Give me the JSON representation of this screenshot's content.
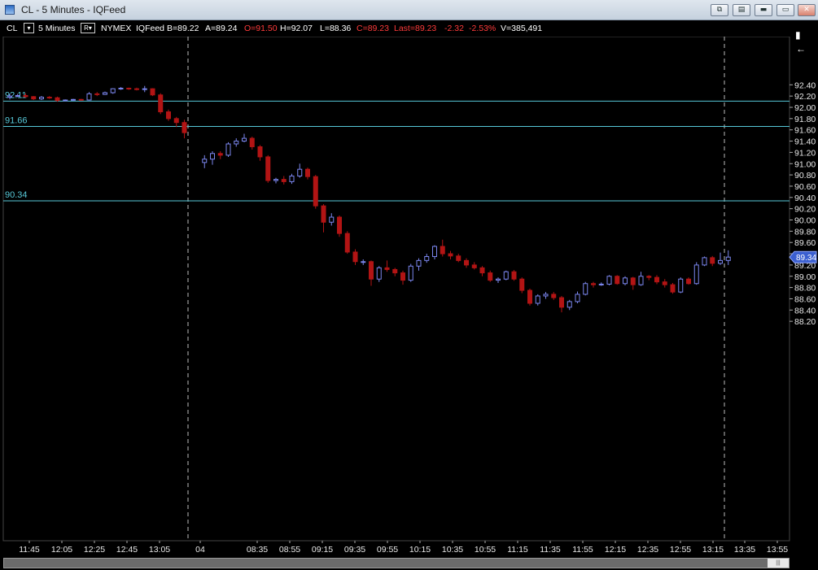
{
  "window": {
    "title": "CL - 5 Minutes - IQFeed",
    "buttons": {
      "restore": "⧉",
      "properties": "▤",
      "minimize": "▬",
      "maximize": "▭",
      "close": "✕"
    }
  },
  "infobar": {
    "symbol": "CL",
    "interval": "5 Minutes",
    "exchange": "NYMEX",
    "feed": "IQFeed",
    "bid": "B=89.22",
    "ask": "A=89.24",
    "open": "O=91.50",
    "high": "H=92.07",
    "low": "L=88.36",
    "close": "C=89.23",
    "last": "Last=89.23",
    "change": "-2.32",
    "change_pct": "-2.53%",
    "volume": "V=385,491",
    "interval_btn": "▾",
    "range_btn": "R▾"
  },
  "colors": {
    "up": "#7b86ee",
    "down": "#b21414",
    "grid": "#3a3a3a",
    "level": "#57c8d8",
    "axis_text": "#e8e8e8",
    "header_red": "#ff3b3b"
  },
  "icons": {
    "pin": "pin-icon",
    "arrow": "arrow-icon"
  },
  "chart_data": {
    "type": "candlestick",
    "symbol": "CL",
    "ylim": [
      88.15,
      92.6
    ],
    "y_ticks": [
      "92.40",
      "92.20",
      "92.00",
      "91.80",
      "91.60",
      "91.40",
      "91.20",
      "91.00",
      "90.80",
      "90.60",
      "90.40",
      "90.20",
      "90.00",
      "89.80",
      "89.60",
      "89.40",
      "89.20",
      "89.00",
      "88.80",
      "88.60",
      "88.40",
      "88.20"
    ],
    "x_ticks": [
      "11:45",
      "12:05",
      "12:25",
      "12:45",
      "13:05",
      "04",
      "08:35",
      "08:55",
      "09:15",
      "09:35",
      "09:55",
      "10:15",
      "10:35",
      "10:55",
      "11:15",
      "11:35",
      "11:55",
      "12:15",
      "12:35",
      "12:55",
      "13:15",
      "13:35",
      "13:55"
    ],
    "levels": [
      "92.11",
      "91.66",
      "90.34"
    ],
    "last_price": "89.34",
    "bars": [
      [
        92.18,
        92.2,
        92.14,
        92.24
      ],
      [
        92.2,
        92.21,
        92.18,
        92.24
      ],
      [
        92.21,
        92.19,
        92.17,
        92.25
      ],
      [
        92.19,
        92.15,
        92.13,
        92.2
      ],
      [
        92.15,
        92.18,
        92.13,
        92.2
      ],
      [
        92.18,
        92.17,
        92.15,
        92.2
      ],
      [
        92.17,
        92.12,
        92.1,
        92.19
      ],
      [
        92.12,
        92.13,
        92.11,
        92.14
      ],
      [
        92.13,
        92.14,
        92.12,
        92.15
      ],
      [
        92.14,
        92.13,
        92.12,
        92.15
      ],
      [
        92.13,
        92.24,
        92.12,
        92.27
      ],
      [
        92.24,
        92.23,
        92.2,
        92.27
      ],
      [
        92.23,
        92.26,
        92.22,
        92.28
      ],
      [
        92.26,
        92.33,
        92.24,
        92.34
      ],
      [
        92.33,
        92.34,
        92.31,
        92.36
      ],
      [
        92.34,
        92.33,
        92.31,
        92.35
      ],
      [
        92.33,
        92.32,
        92.3,
        92.35
      ],
      [
        92.32,
        92.33,
        92.27,
        92.38
      ],
      [
        92.33,
        92.22,
        92.2,
        92.34
      ],
      [
        92.22,
        91.92,
        91.88,
        92.25
      ],
      [
        91.92,
        91.8,
        91.76,
        91.96
      ],
      [
        91.8,
        91.73,
        91.65,
        91.83
      ],
      [
        91.73,
        91.55,
        91.45,
        91.78
      ],
      [
        91.02,
        91.08,
        90.92,
        91.15
      ],
      [
        91.08,
        91.18,
        90.98,
        91.22
      ],
      [
        91.18,
        91.15,
        91.08,
        91.22
      ],
      [
        91.15,
        91.35,
        91.12,
        91.38
      ],
      [
        91.35,
        91.4,
        91.3,
        91.45
      ],
      [
        91.4,
        91.45,
        91.38,
        91.53
      ],
      [
        91.45,
        91.3,
        91.25,
        91.48
      ],
      [
        91.3,
        91.12,
        91.05,
        91.33
      ],
      [
        91.12,
        90.7,
        90.66,
        91.15
      ],
      [
        90.7,
        90.72,
        90.65,
        90.75
      ],
      [
        90.72,
        90.68,
        90.63,
        90.78
      ],
      [
        90.68,
        90.78,
        90.64,
        90.82
      ],
      [
        90.78,
        90.9,
        90.75,
        91.0
      ],
      [
        90.9,
        90.77,
        90.72,
        90.93
      ],
      [
        90.77,
        90.25,
        90.2,
        90.8
      ],
      [
        90.25,
        89.96,
        89.78,
        90.28
      ],
      [
        89.96,
        90.05,
        89.9,
        90.12
      ],
      [
        90.05,
        89.76,
        89.7,
        90.08
      ],
      [
        89.76,
        89.43,
        89.4,
        89.8
      ],
      [
        89.43,
        89.26,
        89.2,
        89.48
      ],
      [
        89.26,
        89.26,
        89.2,
        89.3
      ],
      [
        89.26,
        88.95,
        88.83,
        89.28
      ],
      [
        88.95,
        89.15,
        88.9,
        89.18
      ],
      [
        89.15,
        89.12,
        89.08,
        89.28
      ],
      [
        89.12,
        89.06,
        89.0,
        89.15
      ],
      [
        89.06,
        88.93,
        88.85,
        89.1
      ],
      [
        88.93,
        89.18,
        88.9,
        89.22
      ],
      [
        89.18,
        89.28,
        89.1,
        89.32
      ],
      [
        89.28,
        89.35,
        89.24,
        89.4
      ],
      [
        89.35,
        89.53,
        89.3,
        89.55
      ],
      [
        89.53,
        89.4,
        89.35,
        89.65
      ],
      [
        89.4,
        89.36,
        89.3,
        89.45
      ],
      [
        89.36,
        89.28,
        89.25,
        89.4
      ],
      [
        89.28,
        89.2,
        89.15,
        89.32
      ],
      [
        89.2,
        89.15,
        89.12,
        89.25
      ],
      [
        89.15,
        89.06,
        89.0,
        89.18
      ],
      [
        89.06,
        88.93,
        88.9,
        89.1
      ],
      [
        88.93,
        88.95,
        88.88,
        88.98
      ],
      [
        88.95,
        89.08,
        88.93,
        89.1
      ],
      [
        89.08,
        88.95,
        88.92,
        89.11
      ],
      [
        88.95,
        88.75,
        88.7,
        88.98
      ],
      [
        88.75,
        88.52,
        88.48,
        88.78
      ],
      [
        88.52,
        88.65,
        88.48,
        88.68
      ],
      [
        88.65,
        88.68,
        88.6,
        88.72
      ],
      [
        88.68,
        88.62,
        88.58,
        88.72
      ],
      [
        88.62,
        88.45,
        88.36,
        88.65
      ],
      [
        88.45,
        88.55,
        88.4,
        88.58
      ],
      [
        88.55,
        88.68,
        88.52,
        88.73
      ],
      [
        88.68,
        88.87,
        88.66,
        88.9
      ],
      [
        88.87,
        88.85,
        88.8,
        88.9
      ],
      [
        88.85,
        88.86,
        88.83,
        88.89
      ],
      [
        88.86,
        89.0,
        88.84,
        89.02
      ],
      [
        89.0,
        88.87,
        88.85,
        89.02
      ],
      [
        88.87,
        88.97,
        88.84,
        89.0
      ],
      [
        88.97,
        88.85,
        88.76,
        88.99
      ],
      [
        88.85,
        89.0,
        88.83,
        89.08
      ],
      [
        89.0,
        88.98,
        88.93,
        89.02
      ],
      [
        88.98,
        88.9,
        88.86,
        89.02
      ],
      [
        88.9,
        88.85,
        88.8,
        88.95
      ],
      [
        88.85,
        88.72,
        88.69,
        88.88
      ],
      [
        88.72,
        88.95,
        88.7,
        88.98
      ],
      [
        88.95,
        88.87,
        88.85,
        88.98
      ],
      [
        88.87,
        89.2,
        88.85,
        89.25
      ],
      [
        89.2,
        89.33,
        89.18,
        89.35
      ],
      [
        89.33,
        89.23,
        89.18,
        89.36
      ],
      [
        89.23,
        89.28,
        89.2,
        89.42
      ],
      [
        89.28,
        89.34,
        89.2,
        89.46
      ]
    ]
  }
}
